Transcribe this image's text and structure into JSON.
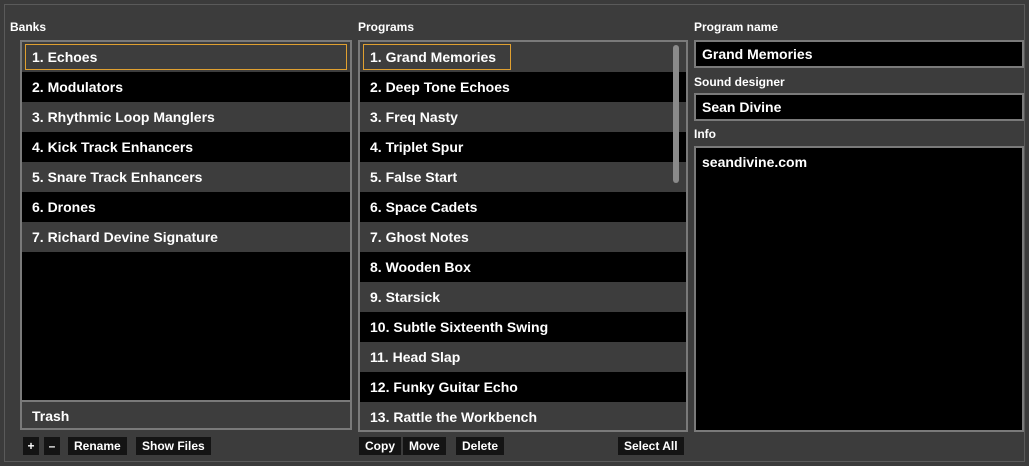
{
  "banks": {
    "label": "Banks",
    "items": [
      "1. Echoes",
      "2. Modulators",
      "3. Rhythmic Loop Manglers",
      "4. Kick Track Enhancers",
      "5. Snare Track Enhancers",
      "6. Drones",
      "7. Richard Devine Signature"
    ],
    "selected_index": 0,
    "trash_label": "Trash",
    "buttons": {
      "add": "+",
      "remove": "–",
      "rename": "Rename",
      "show_files": "Show Files"
    }
  },
  "programs": {
    "label": "Programs",
    "items": [
      "1. Grand Memories",
      "2. Deep Tone Echoes",
      "3. Freq Nasty",
      "4. Triplet Spur",
      "5. False Start",
      "6. Space Cadets",
      "7. Ghost Notes",
      "8. Wooden Box",
      "9. Starsick",
      "10. Subtle Sixteenth Swing",
      "11. Head Slap",
      "12. Funky Guitar Echo",
      "13. Rattle the Workbench"
    ],
    "selected_index": 0,
    "buttons": {
      "copy": "Copy",
      "move": "Move",
      "delete": "Delete",
      "select_all": "Select All"
    }
  },
  "details": {
    "program_name_label": "Program name",
    "program_name": "Grand Memories",
    "sound_designer_label": "Sound designer",
    "sound_designer": "Sean Divine",
    "info_label": "Info",
    "info": "seandivine.com"
  },
  "colors": {
    "selection_outline": "#e0a030",
    "row_alt": "#3d3d3d",
    "row_base": "#000000",
    "panel_bg": "#3c3c3c"
  }
}
